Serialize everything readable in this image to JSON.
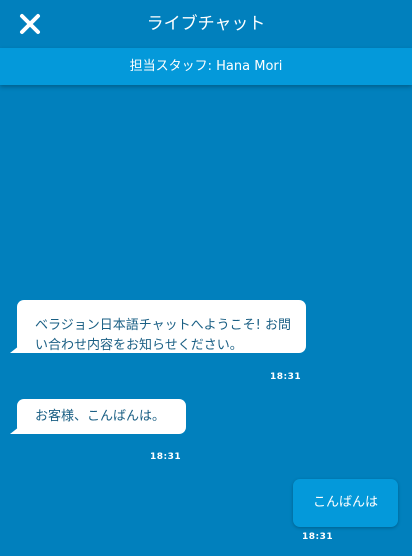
{
  "header": {
    "title": "ライブチャット",
    "close_icon": "close-icon"
  },
  "staff_bar": {
    "text": "担当スタッフ: Hana Mori"
  },
  "messages": [
    {
      "sender": "agent",
      "text": "ベラジョン日本語チャットへようこそ! お問い合わせ内容をお知らせください。",
      "time": "18:31"
    },
    {
      "sender": "agent",
      "text": "お客様、こんばんは。",
      "time": "18:31"
    },
    {
      "sender": "user",
      "text": "こんばんは",
      "time": "18:31"
    }
  ],
  "colors": {
    "background": "#0180bd",
    "staff_bar": "#0499da",
    "agent_bubble": "#ffffff",
    "agent_text": "#1a5f84",
    "user_bubble": "#0499da"
  }
}
